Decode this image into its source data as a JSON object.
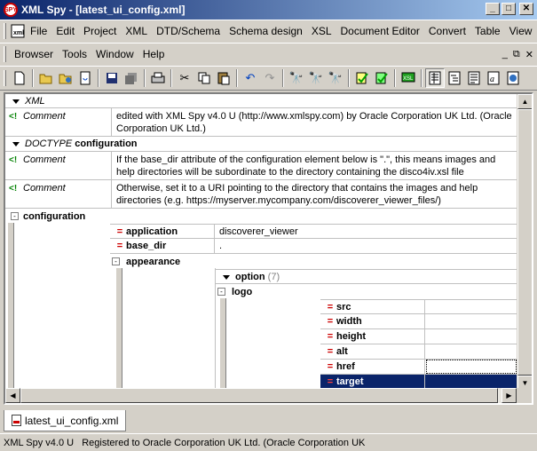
{
  "window": {
    "title": "XML Spy - [latest_ui_config.xml]",
    "app_icon_label": "SPY",
    "minimize": "_",
    "maximize": "□",
    "close": "✕"
  },
  "menu": {
    "row1": [
      "File",
      "Edit",
      "Project",
      "XML",
      "DTD/Schema",
      "Schema design",
      "XSL",
      "Document Editor",
      "Convert",
      "Table",
      "View"
    ],
    "row2": [
      "Browser",
      "Tools",
      "Window",
      "Help"
    ]
  },
  "mdi": {
    "minimize": "_",
    "restore": "⧉",
    "close": "✕"
  },
  "toolbar": {
    "buttons": [
      "new",
      "open",
      "open-url",
      "reload",
      "save",
      "save-all",
      "print",
      "cut",
      "copy",
      "paste",
      "undo",
      "redo",
      "find",
      "find-next",
      "replace",
      "check-wellformed",
      "validate",
      "xsl-transform",
      "grid-view",
      "schema-view",
      "text-view",
      "browser-view"
    ]
  },
  "grid": {
    "rows": [
      {
        "type": "XML",
        "label": "XML"
      },
      {
        "type": "Comment",
        "label": "Comment",
        "text": "edited with XML Spy v4.0 U (http://www.xmlspy.com) by Oracle Corporation UK Ltd. (Oracle Corporation UK Ltd.)"
      },
      {
        "type": "DOCTYPE",
        "label": "DOCTYPE",
        "name": "configuration"
      },
      {
        "type": "Comment",
        "label": "Comment",
        "text": "If the base_dir attribute of the configuration element below is \".\", this means images and help directories will be subordinate to the directory containing the disco4iv.xsl file"
      },
      {
        "type": "Comment",
        "label": "Comment",
        "text": "Otherwise, set it to a URI pointing to the directory that contains the images and help directories (e.g. https://myserver.mycompany.com/discoverer_viewer_files/)"
      }
    ],
    "configuration": {
      "label": "configuration",
      "attrs": [
        {
          "name": "application",
          "value": "discoverer_viewer"
        },
        {
          "name": "base_dir",
          "value": "."
        }
      ],
      "appearance": {
        "label": "appearance",
        "option": {
          "label": "option",
          "count": "(7)"
        },
        "logo": {
          "label": "logo",
          "attrs": [
            {
              "name": "src",
              "value": ""
            },
            {
              "name": "width",
              "value": ""
            },
            {
              "name": "height",
              "value": ""
            },
            {
              "name": "alt",
              "value": ""
            },
            {
              "name": "href",
              "value": ""
            },
            {
              "name": "target",
              "value": "",
              "selected": true
            }
          ]
        }
      }
    }
  },
  "tabs": [
    {
      "label": "latest_ui_config.xml",
      "active": true
    }
  ],
  "status": {
    "text": "XML Spy v4.0 U   Registered to Oracle Corporation UK Ltd. (Oracle Corporation UK"
  }
}
